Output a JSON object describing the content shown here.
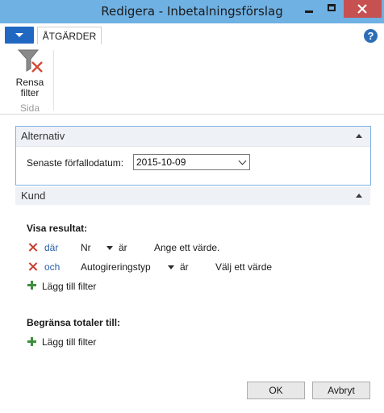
{
  "window": {
    "title": "Redigera - Inbetalningsförslag"
  },
  "ribbon": {
    "tab_actions": "ÅTGÄRDER",
    "clear_filter_label_line1": "Rensa",
    "clear_filter_label_line2": "filter",
    "group_label": "Sida"
  },
  "options": {
    "title": "Alternativ",
    "due_date_label": "Senaste förfallodatum:",
    "due_date_value": "2015-10-09"
  },
  "customer": {
    "title": "Kund",
    "show_results_heading": "Visa resultat:",
    "filters": [
      {
        "conjunction": "där",
        "field": "Nr",
        "operator": "är",
        "value": "Ange ett värde."
      },
      {
        "conjunction": "och",
        "field": "Autogireringstyp",
        "operator": "är",
        "value": "Välj ett värde"
      }
    ],
    "add_filter_label": "Lägg till filter",
    "limit_totals_heading": "Begränsa totaler till:",
    "add_filter_label_2": "Lägg till filter"
  },
  "buttons": {
    "ok": "OK",
    "cancel": "Avbryt"
  },
  "colors": {
    "title_bar": "#6fb1e3",
    "close_button": "#c75050",
    "app_menu": "#2168c2",
    "link_blue": "#2a5fa6",
    "remove_red": "#c7392a",
    "add_green": "#3d8f3d"
  }
}
